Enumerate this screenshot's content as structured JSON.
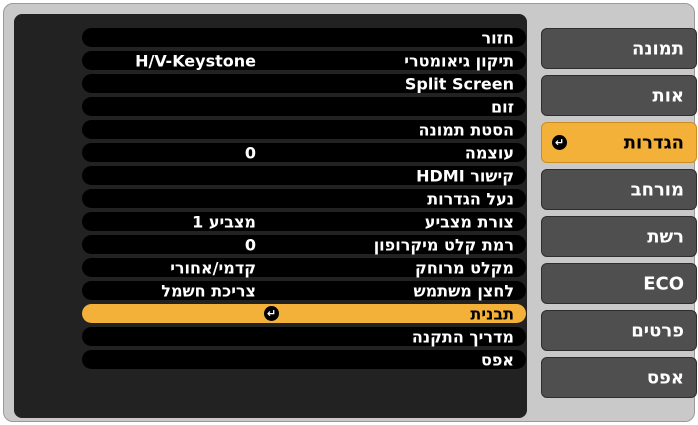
{
  "menu": {
    "items": [
      {
        "label": "חזור",
        "value": ""
      },
      {
        "label": "תיקון גיאומטרי",
        "value": "H/V-Keystone"
      },
      {
        "label": "Split Screen",
        "value": ""
      },
      {
        "label": "זום",
        "value": ""
      },
      {
        "label": "הסטת תמונה",
        "value": ""
      },
      {
        "label": "עוצמה",
        "value": "0"
      },
      {
        "label": "קישור HDMI",
        "value": ""
      },
      {
        "label": "נעל הגדרות",
        "value": ""
      },
      {
        "label": "צורת מצביע",
        "value": "מצביע 1"
      },
      {
        "label": "רמת קלט מיקרופון",
        "value": "0"
      },
      {
        "label": "מקלט מרוחק",
        "value": "קדמי/אחורי"
      },
      {
        "label": "לחצן משתמש",
        "value": "צריכת חשמל"
      },
      {
        "label": "תבנית",
        "value": ""
      },
      {
        "label": "מדריך התקנה",
        "value": ""
      },
      {
        "label": "אפס",
        "value": ""
      }
    ],
    "selected_index": 12
  },
  "tabs": [
    {
      "label": "תמונה"
    },
    {
      "label": "אות"
    },
    {
      "label": "הגדרות"
    },
    {
      "label": "מורחב"
    },
    {
      "label": "רשת"
    },
    {
      "label": "ECO"
    },
    {
      "label": "פרטים"
    },
    {
      "label": "אפס"
    }
  ],
  "active_tab_index": 2,
  "icons": {
    "enter": "enter-icon"
  },
  "colors": {
    "selected": "#f3b13a",
    "panel": "#222222",
    "tab": "#4f4f4f",
    "frame": "#c9c9c9"
  }
}
